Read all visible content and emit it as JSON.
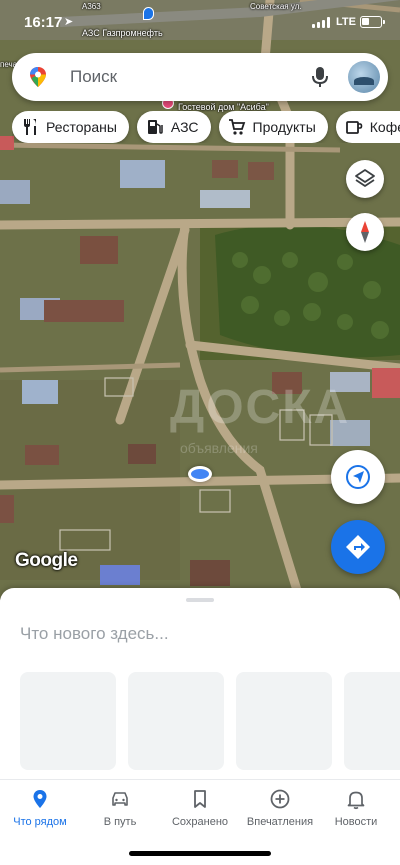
{
  "status_bar": {
    "time": "16:17",
    "network": "LTE",
    "battery_level": 0.4
  },
  "map": {
    "labels": {
      "road": "А363",
      "fuel_station": "АЗС Газпромнефть",
      "street": "Советская ул.",
      "left_edge": "печать\nиль",
      "guest_house": "Гостевой дом \"Асиба\""
    },
    "attribution": "Google",
    "watermark": "ДОСКА",
    "watermark_sub": "объявления"
  },
  "search": {
    "placeholder": "Поиск"
  },
  "chips": [
    {
      "label": "Рестораны",
      "icon": "restaurant-icon"
    },
    {
      "label": "АЗС",
      "icon": "gas-station-icon"
    },
    {
      "label": "Продукты",
      "icon": "cart-icon"
    },
    {
      "label": "Кофейни",
      "icon": "coffee-icon"
    }
  ],
  "sheet": {
    "title": "Что нового здесь..."
  },
  "nav": [
    {
      "label": "Что рядом",
      "icon": "location-pin-icon",
      "active": true
    },
    {
      "label": "В путь",
      "icon": "car-icon",
      "active": false
    },
    {
      "label": "Сохранено",
      "icon": "bookmark-icon",
      "active": false
    },
    {
      "label": "Впечатления",
      "icon": "add-circle-icon",
      "active": false
    },
    {
      "label": "Новости",
      "icon": "bell-icon",
      "active": false
    }
  ],
  "colors": {
    "accent": "#1a73e8",
    "location": "#4285f4"
  }
}
